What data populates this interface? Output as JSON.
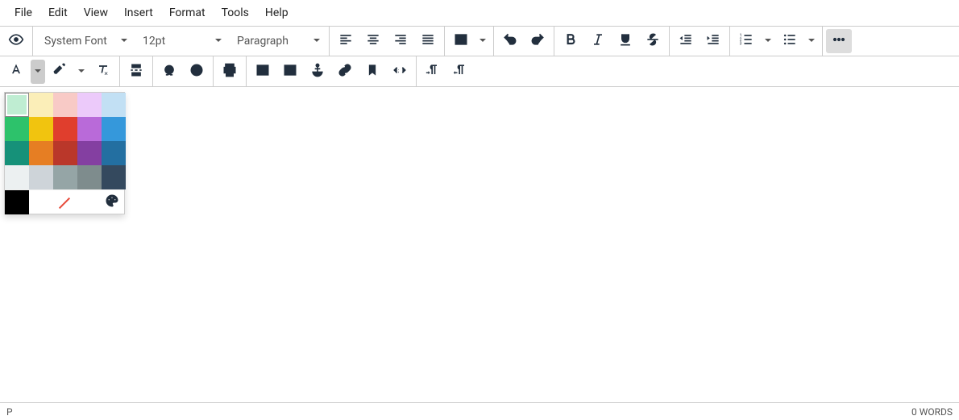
{
  "menubar": [
    "File",
    "Edit",
    "View",
    "Insert",
    "Format",
    "Tools",
    "Help"
  ],
  "toolbar1": {
    "font": "System Font",
    "size": "12pt",
    "block": "Paragraph"
  },
  "statusbar": {
    "path": "P",
    "words": "0 WORDS"
  },
  "color_picker": {
    "selected": "#BFEDD2",
    "grid": [
      "#BFEDD2",
      "#FBEEB8",
      "#F8CAC6",
      "#ECCAFA",
      "#C2E0F4",
      "#2DC26B",
      "#F1C40F",
      "#E03E2D",
      "#B96AD9",
      "#3598DB",
      "#169179",
      "#E67E23",
      "#BA372A",
      "#843FA1",
      "#236FA1",
      "#ECF0F1",
      "#CED4D9",
      "#95A5A6",
      "#7E8C8D",
      "#34495E"
    ]
  },
  "icons": {
    "preview": "preview",
    "chev": "chev",
    "align_left": "align-left",
    "align_center": "align-center",
    "align_right": "align-right",
    "align_justify": "align-justify",
    "table": "table",
    "undo": "undo",
    "redo": "redo",
    "bold": "bold",
    "italic": "italic",
    "underline": "underline",
    "strike": "strike",
    "outdent": "outdent",
    "indent": "indent",
    "ol": "ordered-list",
    "ul": "unordered-list",
    "more": "more",
    "textcolor": "text-color",
    "bgcolor": "bg-color",
    "clearfmt": "clear-format",
    "pagebreak": "page-break",
    "charmap": "special-char",
    "emoji": "emoji",
    "print": "print",
    "image": "image",
    "media": "media",
    "stamp": "anchor",
    "link": "link",
    "bookmark": "bookmark",
    "codesample": "code-sample",
    "ltr": "ltr",
    "rtl": "rtl",
    "palette": "palette",
    "nocolor": "no-color",
    "black": "black"
  }
}
